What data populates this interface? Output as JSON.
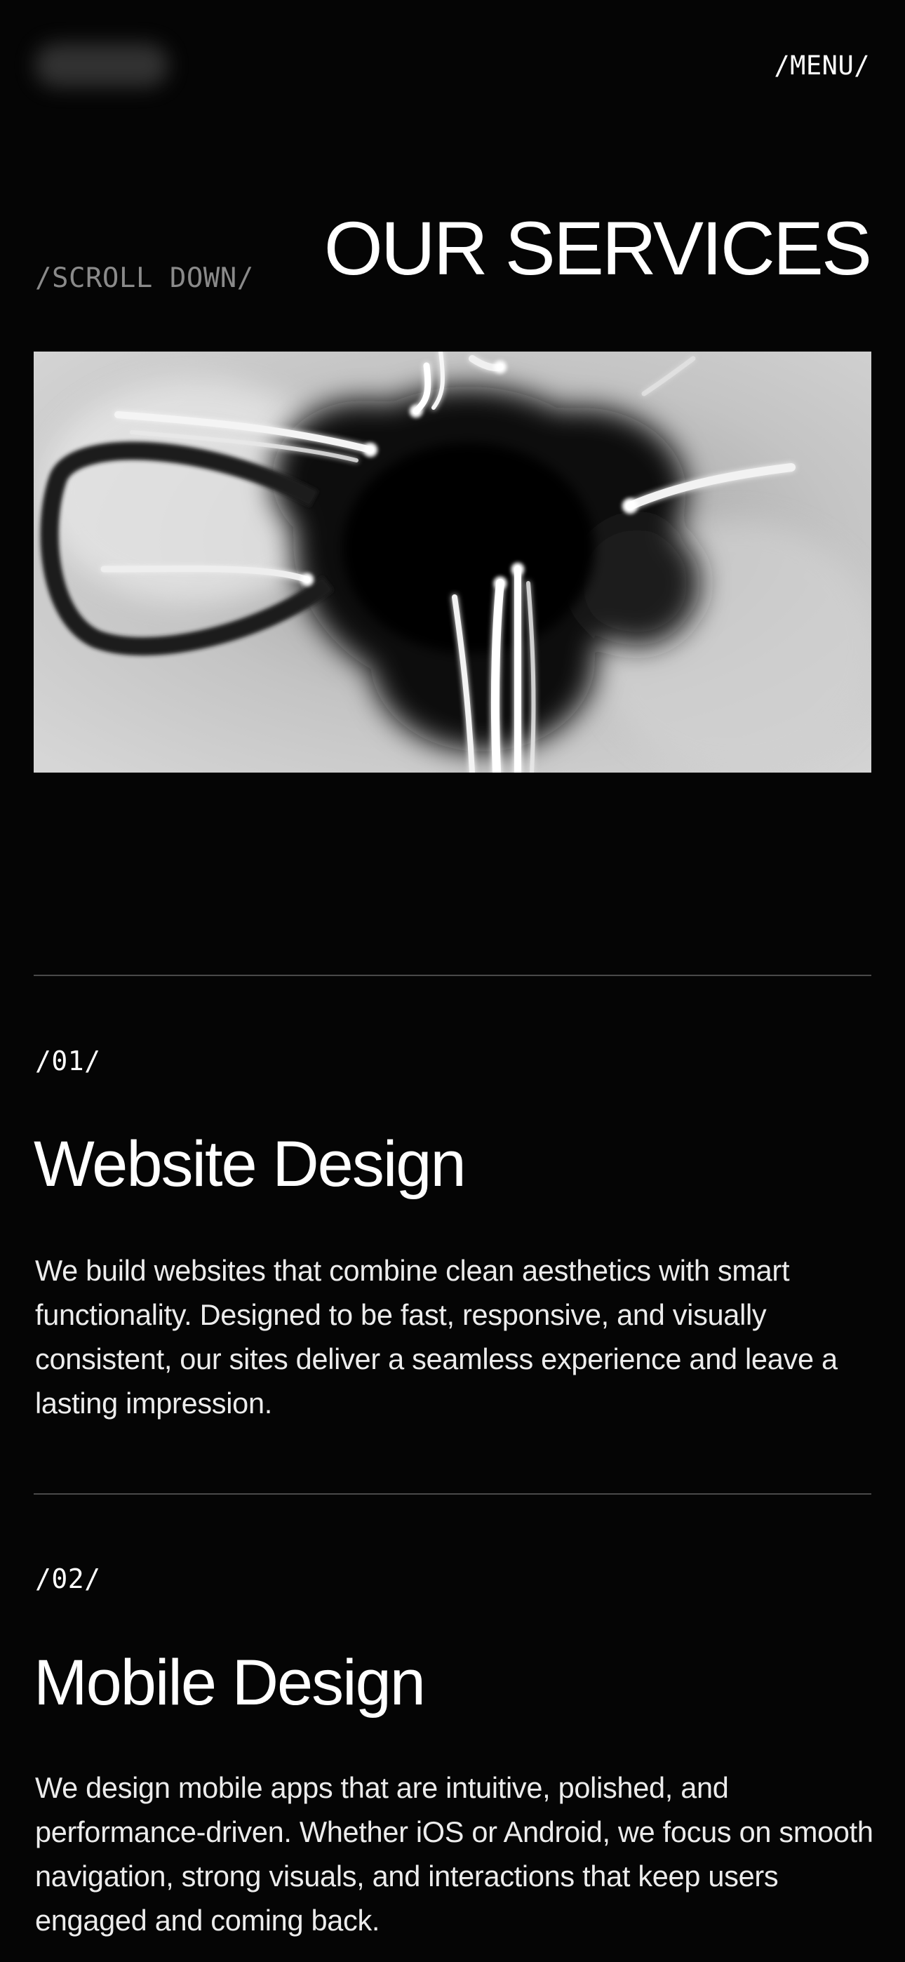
{
  "header": {
    "logo_alt": "",
    "menu_label": "/MENU/"
  },
  "hero": {
    "scroll_hint": "/SCROLL DOWN/",
    "title": "OUR SERVICES",
    "image": "abstract-light-streaks-image"
  },
  "services": [
    {
      "number": "/01/",
      "title": "Website Design",
      "description": "We build websites that combine clean aesthetics with smart functionality. Designed to be fast, responsive, and visually consistent, our sites deliver a seamless experience and leave a lasting impression."
    },
    {
      "number": "/02/",
      "title": "Mobile Design",
      "description": "We design mobile apps that are intuitive, polished, and performance-driven. Whether iOS or Android, we focus on smooth navigation, strong visuals, and interactions that keep users engaged and coming back."
    }
  ],
  "colors": {
    "background": "#050505",
    "text": "#ffffff",
    "muted_text": "#8a8a8a",
    "divider": "#4a4a4a"
  }
}
